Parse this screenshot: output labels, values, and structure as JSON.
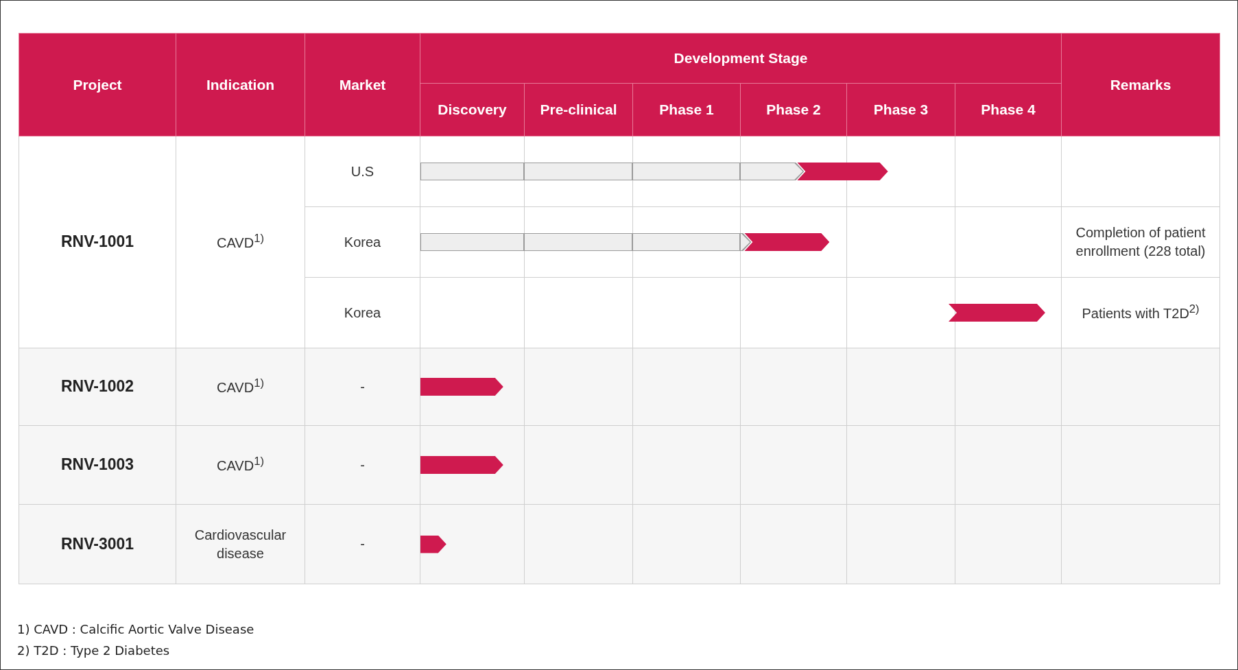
{
  "header": {
    "project": "Project",
    "indication": "Indication",
    "market": "Market",
    "development_stage": "Development Stage",
    "remarks": "Remarks",
    "stages": [
      "Discovery",
      "Pre-clinical",
      "Phase 1",
      "Phase 2",
      "Phase 3",
      "Phase 4"
    ]
  },
  "projects": [
    {
      "name": "RNV-1001",
      "indication": "CAVD$^{1)}$",
      "markets": [
        {
          "market": "U.S",
          "stages": [
            {
              "kind": "completed"
            },
            {
              "kind": "completed"
            },
            {
              "kind": "completed"
            },
            {
              "kind": "completed_then_current"
            },
            {
              "kind": "current_end"
            },
            {
              "kind": "empty"
            }
          ]
        },
        {
          "market": "Korea",
          "stages": [
            {
              "kind": "completed"
            },
            {
              "kind": "completed"
            },
            {
              "kind": "completed"
            },
            {
              "kind": "completed_then_current_end"
            },
            {
              "kind": "empty"
            },
            {
              "kind": "empty"
            }
          ],
          "remarks": "Completion of patient enrollment (228 total)"
        },
        {
          "market": "Korea",
          "stages": [
            {
              "kind": "empty"
            },
            {
              "kind": "empty"
            },
            {
              "kind": "empty"
            },
            {
              "kind": "empty"
            },
            {
              "kind": "empty"
            },
            {
              "kind": "current_notched"
            }
          ],
          "remarks": "Patients with T2D$^{2)}$"
        }
      ]
    },
    {
      "name": "RNV-1002",
      "indication": "CAVD$^{1)}$",
      "markets": [
        {
          "market": "-",
          "stages": [
            {
              "kind": "current"
            },
            {
              "kind": "empty"
            },
            {
              "kind": "empty"
            },
            {
              "kind": "empty"
            },
            {
              "kind": "empty"
            },
            {
              "kind": "empty"
            }
          ]
        }
      ]
    },
    {
      "name": "RNV-1003",
      "indication": "CAVD$^{1)}$",
      "markets": [
        {
          "market": "-",
          "stages": [
            {
              "kind": "current"
            },
            {
              "kind": "empty"
            },
            {
              "kind": "empty"
            },
            {
              "kind": "empty"
            },
            {
              "kind": "empty"
            },
            {
              "kind": "empty"
            }
          ]
        }
      ]
    },
    {
      "name": "RNV-3001",
      "indication": "Cardiovascular disease",
      "markets": [
        {
          "market": "-",
          "stages": [
            {
              "kind": "current_short"
            },
            {
              "kind": "empty"
            },
            {
              "kind": "empty"
            },
            {
              "kind": "empty"
            },
            {
              "kind": "empty"
            },
            {
              "kind": "empty"
            }
          ]
        }
      ]
    }
  ],
  "footnotes": [
    "1) CAVD : Calcific Aortic Valve Disease",
    "2) T2D : Type 2 Diabetes"
  ]
}
